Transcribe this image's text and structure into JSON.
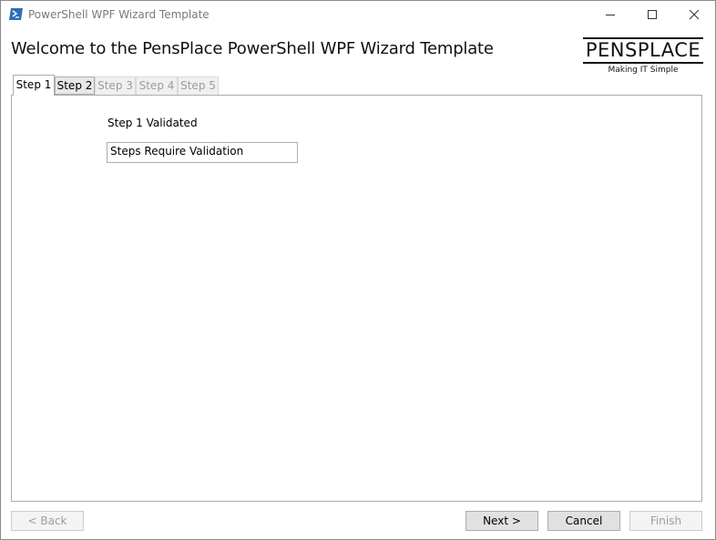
{
  "window": {
    "title": "PowerShell WPF Wizard Template",
    "app_icon": "powershell-icon",
    "controls": [
      "minimize-icon",
      "maximize-icon",
      "close-icon"
    ]
  },
  "header": {
    "title": "Welcome to the PensPlace PowerShell WPF Wizard Template",
    "logo": {
      "name": "PENSPLACE",
      "tagline": "Making IT Simple"
    }
  },
  "tabs": [
    {
      "label": "Step 1",
      "state": "selected"
    },
    {
      "label": "Step 2",
      "state": "enabled"
    },
    {
      "label": "Step 3",
      "state": "disabled"
    },
    {
      "label": "Step 4",
      "state": "disabled"
    },
    {
      "label": "Step 5",
      "state": "disabled"
    }
  ],
  "step1": {
    "status_label": "Step 1 Validated",
    "validation_value": "Steps Require Validation"
  },
  "footer": {
    "back_label": "< Back",
    "next_label": "Next >",
    "cancel_label": "Cancel",
    "finish_label": "Finish"
  },
  "colors": {
    "accent_icon": "#2b6fb3",
    "disabled_text": "#9d9d9d",
    "button_face": "#e1e1e1"
  }
}
